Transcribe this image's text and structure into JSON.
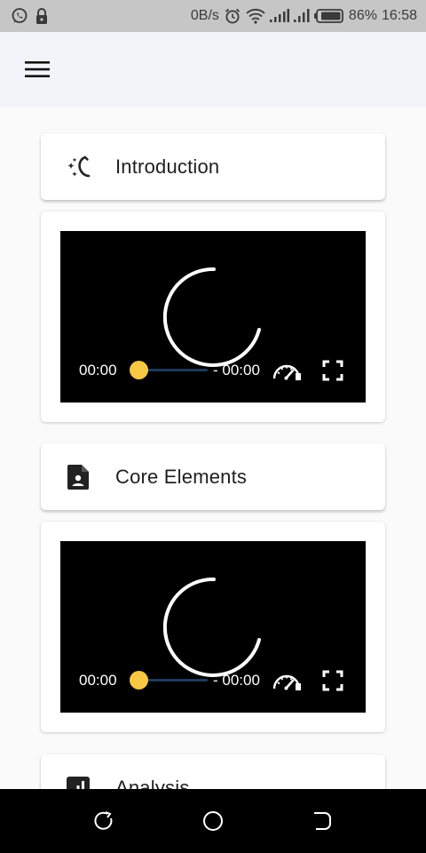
{
  "status_bar": {
    "network_speed": "0B/s",
    "battery": "86%",
    "time": "16:58"
  },
  "app_bar": {
    "menu_icon": "hamburger-menu-icon"
  },
  "sections": [
    {
      "title": "Introduction",
      "icon": "sparkle-moon-icon",
      "video": {
        "current_time": "00:00",
        "remaining_time": "- 00:00",
        "progress": 0
      }
    },
    {
      "title": "Core Elements",
      "icon": "person-document-icon",
      "video": {
        "current_time": "00:00",
        "remaining_time": "- 00:00",
        "progress": 0
      }
    },
    {
      "title": "Analysis",
      "icon": "bar-chart-icon"
    }
  ],
  "colors": {
    "status_bar_bg": "#c6c6c6",
    "app_bar_bg": "#f2f4fa",
    "page_bg": "#fafafa",
    "seek_knob": "#f7c844",
    "seek_track": "#1e3a5c",
    "video_bg": "#000000",
    "nav_bar_bg": "#000000"
  },
  "nav_bar": {
    "recents_icon": "recents-icon",
    "home_icon": "home-circle-icon",
    "back_icon": "back-icon"
  }
}
